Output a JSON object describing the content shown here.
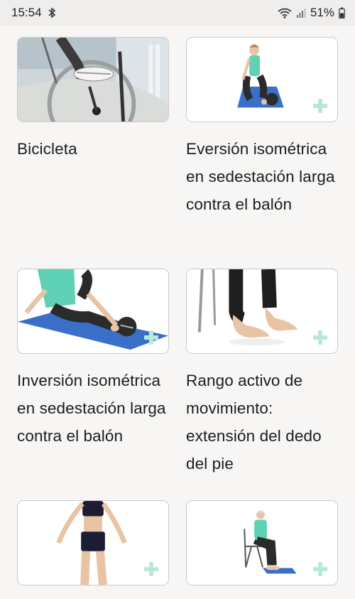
{
  "status_bar": {
    "time": "15:54",
    "battery": "51%",
    "icons": [
      "bluetooth-icon",
      "wifi-icon",
      "signal-icon",
      "battery-icon"
    ]
  },
  "exercises": [
    {
      "title": "Bicicleta",
      "image": "stationary-bike-image"
    },
    {
      "title": "Eversión isométrica en sedestación larga contra el balón",
      "image": "seated-eversion-ball-image"
    },
    {
      "title": "Inversión isométrica en sedestación larga contra el balón",
      "image": "seated-inversion-ball-image"
    },
    {
      "title": "Rango activo de movimiento: extensión del dedo del pie",
      "image": "toe-extension-feet-image"
    },
    {
      "title": "",
      "image": "standing-exercise-woman-image"
    },
    {
      "title": "",
      "image": "seated-chair-towel-image"
    }
  ],
  "colors": {
    "accent_plus": "#b9e8da",
    "mat_blue": "#3a6fc9",
    "shirt_teal": "#5fd1b4"
  }
}
